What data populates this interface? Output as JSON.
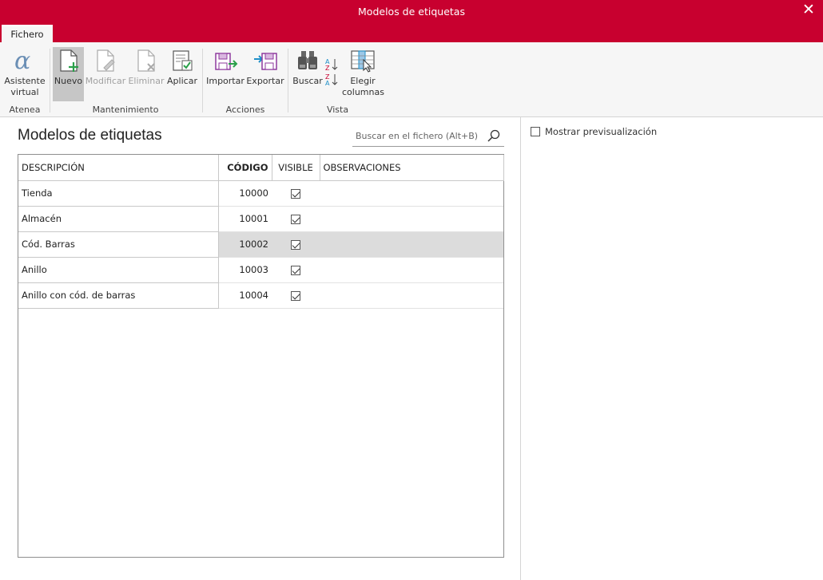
{
  "window": {
    "title": "Modelos de etiquetas",
    "close_glyph": "✕"
  },
  "tabs": [
    {
      "label": "Fichero"
    }
  ],
  "ribbon": {
    "groups": [
      {
        "label": "Atenea",
        "buttons": [
          {
            "label_1": "Asistente",
            "label_2": "virtual",
            "icon": "alpha-icon"
          }
        ]
      },
      {
        "label": "Mantenimiento",
        "buttons": [
          {
            "label": "Nuevo",
            "icon": "new-document-icon",
            "state": "active"
          },
          {
            "label": "Modificar",
            "icon": "edit-document-icon",
            "state": "disabled"
          },
          {
            "label": "Eliminar",
            "icon": "delete-document-icon",
            "state": "disabled"
          },
          {
            "label": "Aplicar",
            "icon": "apply-icon"
          }
        ]
      },
      {
        "label": "Acciones",
        "buttons": [
          {
            "label": "Importar",
            "icon": "import-icon"
          },
          {
            "label": "Exportar",
            "icon": "export-icon"
          }
        ]
      },
      {
        "label": "Vista",
        "buttons": [
          {
            "label": "Buscar",
            "icon": "binoculars-icon"
          },
          {
            "label": "",
            "icon": "sort-az-icon"
          },
          {
            "label_1": "Elegir",
            "label_2": "columnas",
            "icon": "choose-columns-icon"
          }
        ]
      }
    ]
  },
  "main": {
    "title": "Modelos de etiquetas",
    "search_placeholder": "Buscar en el fichero (Alt+B)",
    "table": {
      "columns": [
        "DESCRIPCIÓN",
        "CÓDIGO",
        "VISIBLE",
        "OBSERVACIONES"
      ],
      "rows": [
        {
          "descripcion": "Tienda",
          "codigo": "10000",
          "visible": true,
          "observaciones": ""
        },
        {
          "descripcion": "Almacén",
          "codigo": "10001",
          "visible": true,
          "observaciones": ""
        },
        {
          "descripcion": "Cód. Barras",
          "codigo": "10002",
          "visible": true,
          "observaciones": "",
          "selected": true
        },
        {
          "descripcion": "Anillo",
          "codigo": "10003",
          "visible": true,
          "observaciones": ""
        },
        {
          "descripcion": "Anillo con cód. de barras",
          "codigo": "10004",
          "visible": true,
          "observaciones": ""
        }
      ]
    }
  },
  "side_panel": {
    "preview_label": "Mostrar previsualización",
    "preview_checked": false
  },
  "colors": {
    "accent": "#c8002f",
    "ribbon_bg": "#f6f6f6",
    "selected_row": "#dcdcdc"
  }
}
